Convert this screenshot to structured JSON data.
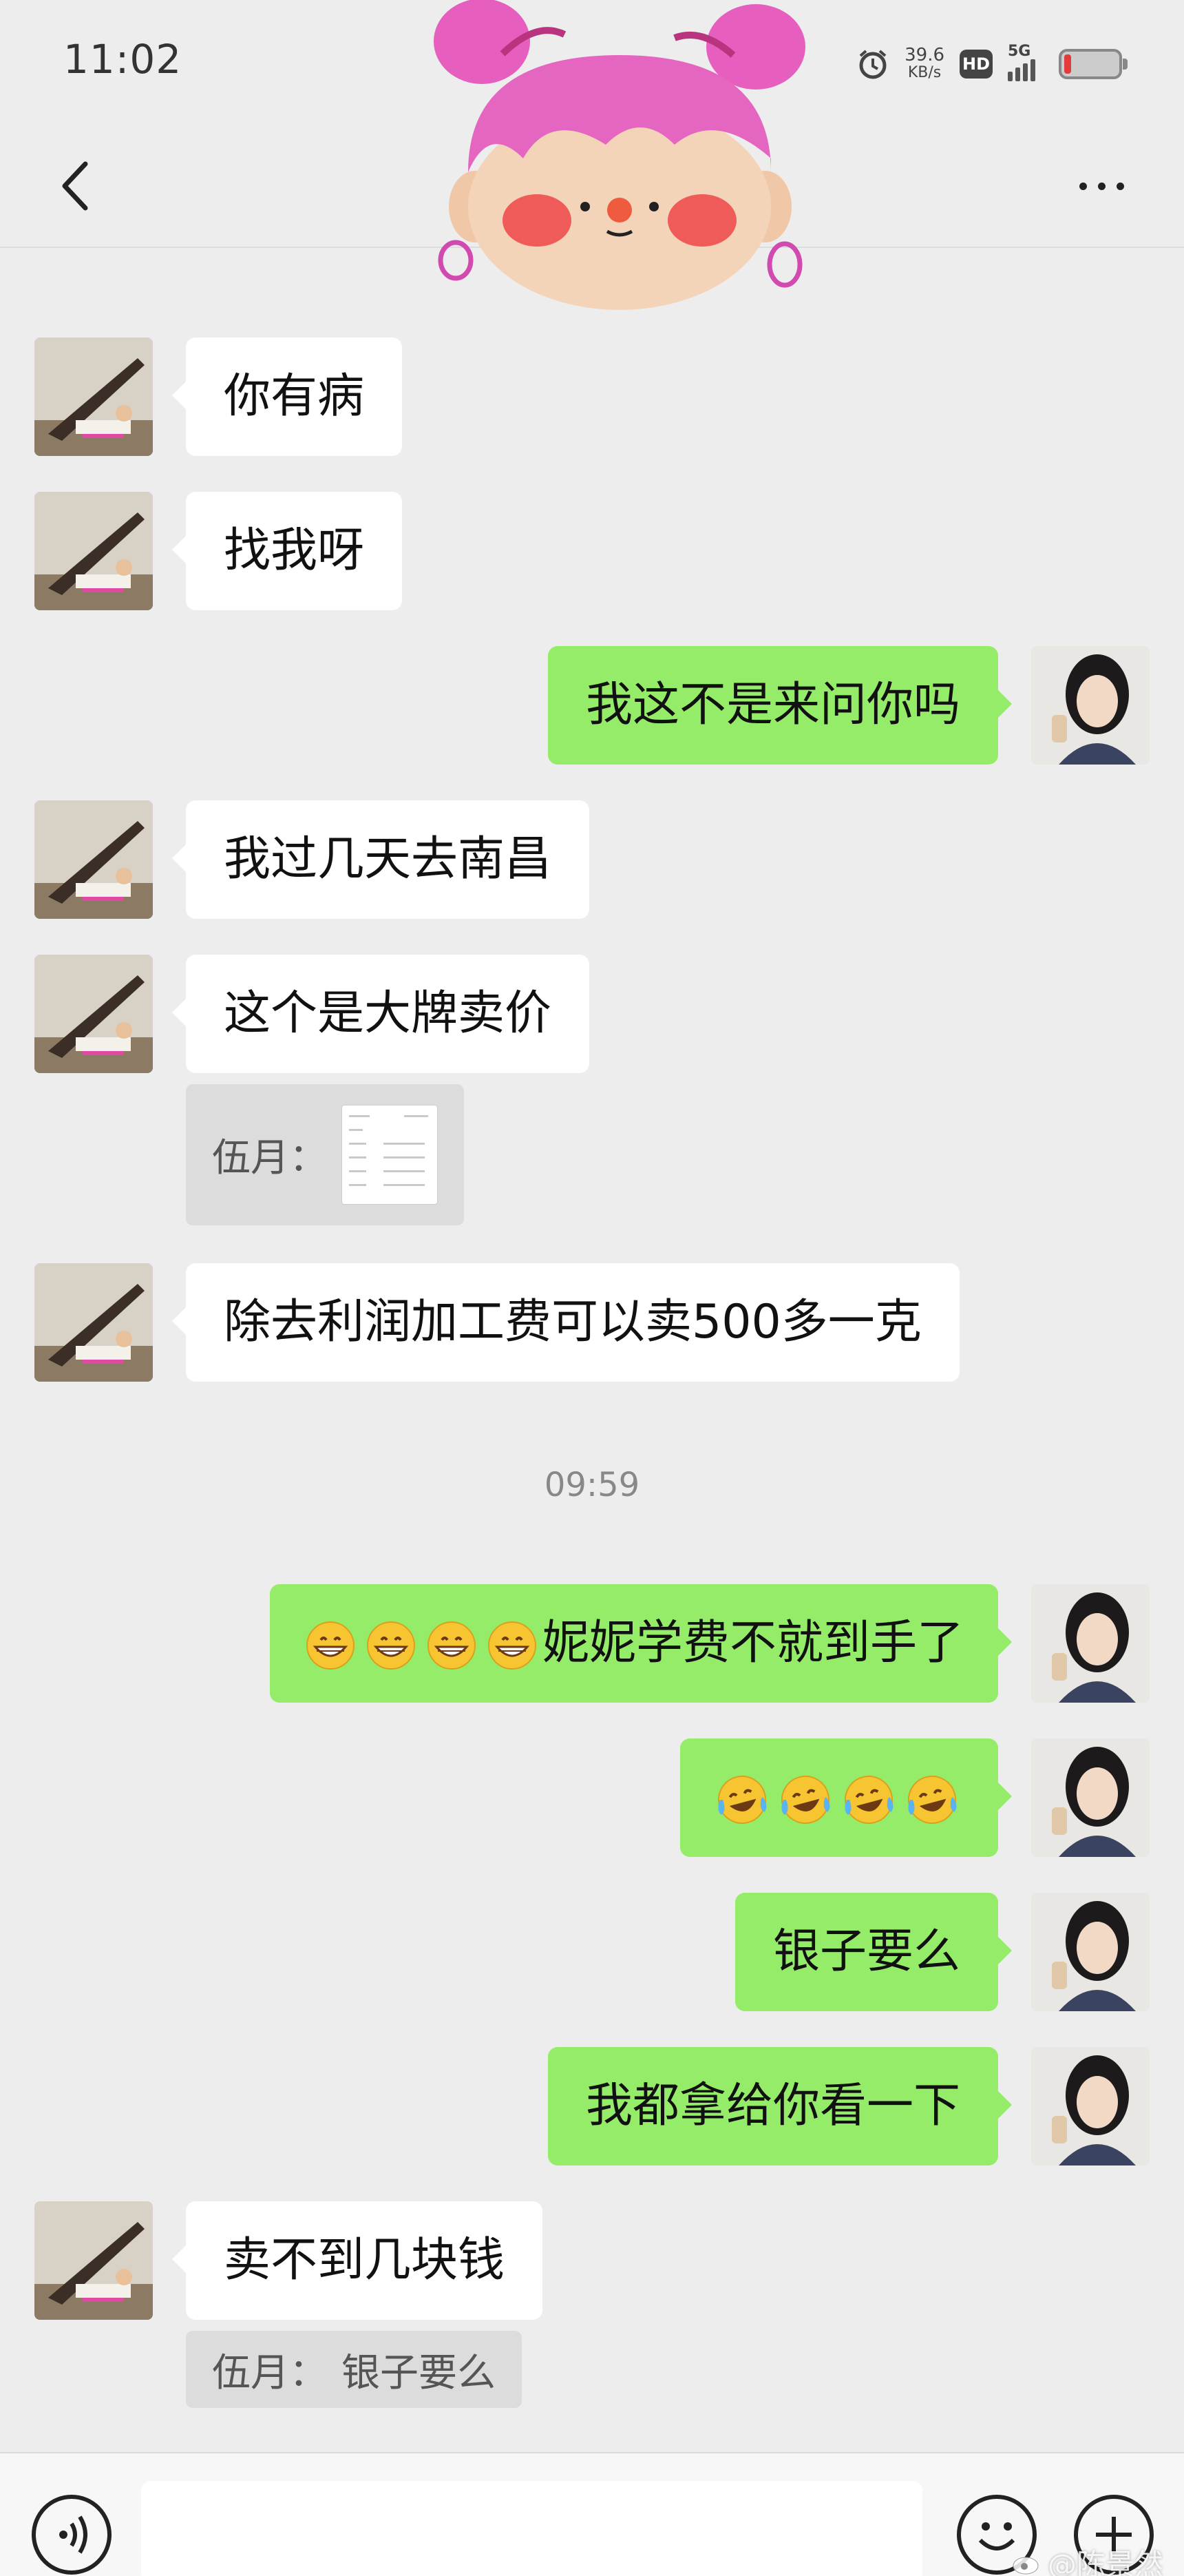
{
  "status_bar": {
    "time": "11:02",
    "speed_value": "39.6",
    "speed_unit": "KB/s",
    "hd_label": "HD",
    "network_label": "5G",
    "battery_color": "#e23b3b"
  },
  "nav": {
    "back_icon": "chevron-left-icon",
    "more_icon": "more-dots-icon"
  },
  "messages": [
    {
      "side": "left",
      "text": "你有病"
    },
    {
      "side": "left",
      "text": "找我呀"
    },
    {
      "side": "right",
      "text": "我这不是来问你吗"
    },
    {
      "side": "left",
      "text": "我过几天去南昌"
    },
    {
      "side": "left",
      "text": "这个是大牌卖价",
      "quote": {
        "sender": "伍月：",
        "type": "image"
      }
    },
    {
      "side": "left",
      "text": "除去利润加工费可以卖500多一克"
    },
    {
      "side": "right",
      "text": "妮妮学费不就到手了",
      "emoji": "grin-emoji",
      "emoji_count": 4
    },
    {
      "side": "right",
      "text": "",
      "emoji": "laugh-cry-emoji",
      "emoji_count": 4
    },
    {
      "side": "right",
      "text": "银子要么"
    },
    {
      "side": "right",
      "text": "我都拿给你看一下"
    },
    {
      "side": "left",
      "text": "卖不到几块钱",
      "quote": {
        "sender": "伍月：",
        "text": "银子要么"
      }
    }
  ],
  "time_divider": "09:59",
  "input_bar": {
    "voice_icon": "voice-icon",
    "emoji_icon": "smiley-icon",
    "plus_icon": "plus-icon",
    "placeholder": ""
  },
  "watermark": "@陈景然",
  "colors": {
    "background": "#ededed",
    "incoming_bubble": "#ffffff",
    "outgoing_bubble": "#95ec69"
  }
}
